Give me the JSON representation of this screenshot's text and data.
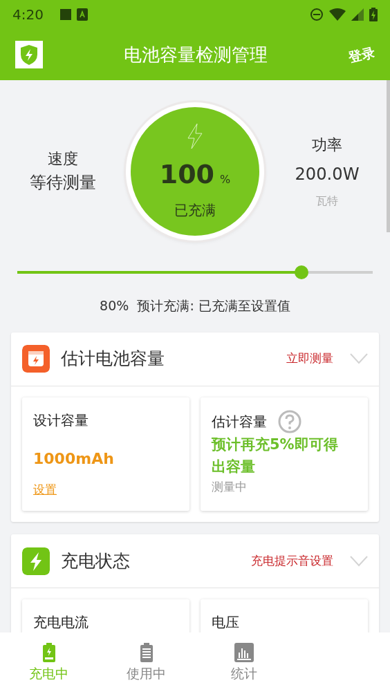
{
  "status_bar": {
    "time": "4:20"
  },
  "app_bar": {
    "title": "电池容量检测管理",
    "action": "登录"
  },
  "hero": {
    "speed_label": "速度",
    "speed_value": "等待测量",
    "percent": "100",
    "percent_unit": "%",
    "charge_state": "已充满",
    "power_label": "功率",
    "power_value": "200.0W",
    "power_unit": "瓦特"
  },
  "slider": {
    "level": 0.8,
    "caption": "80%  预计充满: 已充满至设置值"
  },
  "sections": [
    {
      "kind": "capacity",
      "title": "估计电池容量",
      "action": "立即测量",
      "expanded": false,
      "tiles": [
        {
          "kind": "amount",
          "label": "设计容量",
          "value": "1000mAh",
          "link": "设置"
        },
        {
          "kind": "note",
          "label": "估计容量",
          "help": true,
          "value": "预计再充5%即可得出容量",
          "sub": "测量中"
        }
      ]
    },
    {
      "kind": "charging",
      "title": "充电状态",
      "action": "充电提示音设置",
      "expanded": false,
      "tiles": [
        {
          "label": "充电电流"
        },
        {
          "label": "电压"
        }
      ]
    }
  ],
  "tabs": [
    {
      "label": "充电中",
      "selected": true
    },
    {
      "label": "使用中",
      "selected": false
    },
    {
      "label": "统计",
      "selected": false
    }
  ]
}
